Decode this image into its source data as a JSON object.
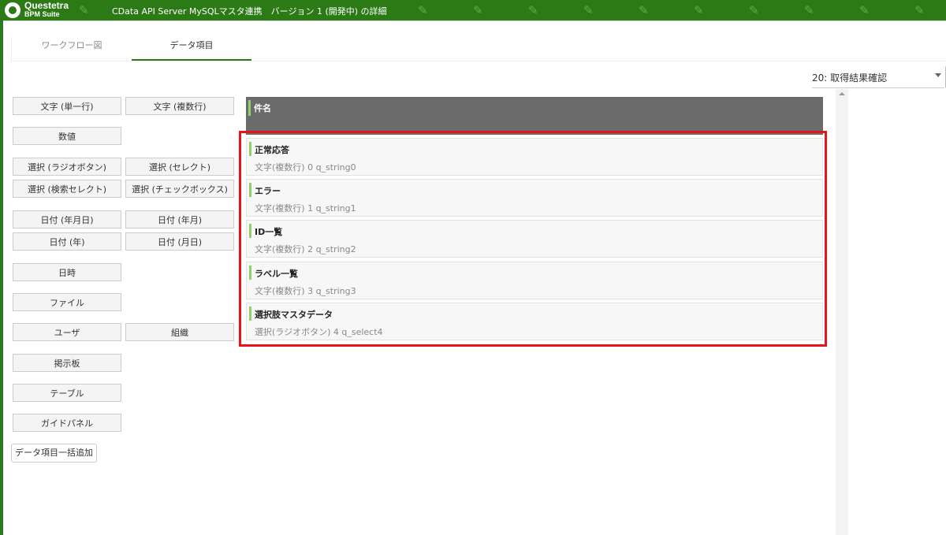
{
  "header": {
    "brand_line1": "Questetra",
    "brand_line2": "BPM Suite",
    "app_title": "CData API Server MySQLマスタ連携　バージョン 1 (開発中) の詳細"
  },
  "tabs": {
    "workflow": "ワークフロー図",
    "data_items": "データ項目"
  },
  "step_selector": {
    "value": "20: 取得結果確認"
  },
  "palette": {
    "text_single": "文字 (単一行)",
    "text_multi": "文字 (複数行)",
    "number": "数値",
    "select_radio": "選択 (ラジオボタン)",
    "select_dropdown": "選択 (セレクト)",
    "select_search": "選択 (検索セレクト)",
    "select_checkbox": "選択 (チェックボックス)",
    "date_ymd": "日付 (年月日)",
    "date_ym": "日付 (年月)",
    "date_y": "日付 (年)",
    "date_md": "日付 (月日)",
    "datetime": "日時",
    "file": "ファイル",
    "user": "ユーザ",
    "org": "組織",
    "board": "掲示板",
    "table": "テーブル",
    "guide_panel": "ガイドパネル",
    "bulk_add": "データ項目一括追加"
  },
  "title_field": {
    "label": "件名"
  },
  "fields": [
    {
      "name": "正常応答",
      "meta": "文字(複数行) 0 q_string0"
    },
    {
      "name": "エラー",
      "meta": "文字(複数行) 1 q_string1"
    },
    {
      "name": "ID一覧",
      "meta": "文字(複数行) 2 q_string2"
    },
    {
      "name": "ラベル一覧",
      "meta": "文字(複数行) 3 q_string3"
    },
    {
      "name": "選択肢マスタデータ",
      "meta": "選択(ラジオボタン) 4 q_select4"
    }
  ],
  "colors": {
    "header_green": "#2b7a16",
    "accent_green": "#8fd16a",
    "highlight_red": "#e8141a",
    "title_bar_gray": "#6b6b6b"
  },
  "icons": {
    "header_pattern": "pencil-icon",
    "step_dropdown": "chevron-down-icon"
  }
}
